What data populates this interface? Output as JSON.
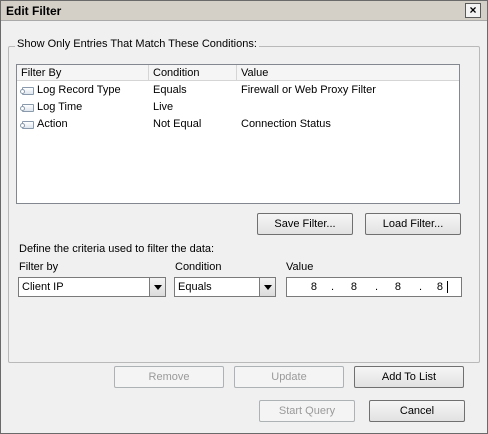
{
  "window": {
    "title": "Edit Filter",
    "close_symbol": "×"
  },
  "group": {
    "legend": "Show Only Entries That Match These Conditions:"
  },
  "list": {
    "columns": [
      "Filter By",
      "Condition",
      "Value"
    ],
    "rows": [
      {
        "filter_by": "Log Record Type",
        "condition": "Equals",
        "value": "Firewall or Web Proxy Filter"
      },
      {
        "filter_by": "Log Time",
        "condition": "Live",
        "value": ""
      },
      {
        "filter_by": "Action",
        "condition": "Not Equal",
        "value": "Connection Status"
      }
    ]
  },
  "buttons": {
    "save_filter": "Save Filter...",
    "load_filter": "Load Filter...",
    "remove": "Remove",
    "update": "Update",
    "add_to_list": "Add To List",
    "start_query": "Start Query",
    "cancel": "Cancel"
  },
  "criteria": {
    "instruction": "Define the criteria used to filter the data:",
    "filter_by_label": "Filter by",
    "condition_label": "Condition",
    "value_label": "Value",
    "filter_by_selected": "Client IP",
    "condition_selected": "Equals",
    "ip_octets": [
      "8",
      "8",
      "8",
      "8"
    ],
    "ip_separator": "."
  }
}
